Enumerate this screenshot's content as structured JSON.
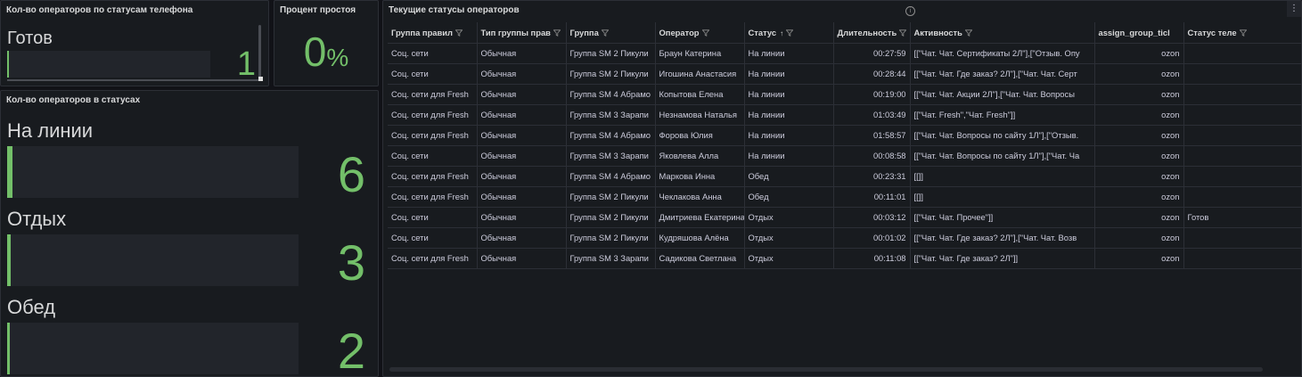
{
  "panels": {
    "phone_status": {
      "title": "Кол-во операторов по статусам телефона",
      "label": "Готов",
      "value": "1",
      "fill_fraction": 0.01
    },
    "idle_percent": {
      "title": "Процент простоя",
      "value": "0",
      "unit": "%"
    },
    "status_counts": {
      "title": "Кол-во операторов в статусах",
      "items": [
        {
          "label": "На линии",
          "value": "6",
          "fill_fraction": 0.02
        },
        {
          "label": "Отдых",
          "value": "3",
          "fill_fraction": 0.02
        },
        {
          "label": "Обед",
          "value": "2",
          "fill_fraction": 0.02
        }
      ]
    },
    "current_statuses": {
      "title": "Текущие статусы операторов",
      "info_icon": "info-circle-icon",
      "menu_icon": "more-vertical-icon",
      "columns": [
        "Группа правил",
        "Тип группы прав",
        "Группа",
        "Оператор",
        "Статус",
        "Длительность",
        "Активность",
        "assign_group_ticl",
        "Статус теле"
      ],
      "sort_icon": "arrow-up-icon",
      "filter_icon": "filter-icon",
      "rows": [
        [
          "Соц. сети",
          "Обычная",
          "Группа SM 2 Пикули",
          "Браун Катерина",
          "На линии",
          "00:27:59",
          "[[\"Чат. Чат. Сертификаты 2Л\"],[\"Отзыв. Опу",
          "ozon",
          ""
        ],
        [
          "Соц. сети",
          "Обычная",
          "Группа SM 2 Пикули",
          "Игошина Анастасия",
          "На линии",
          "00:28:44",
          "[[\"Чат. Чат. Где заказ? 2Л\"],[\"Чат. Чат. Серт",
          "ozon",
          ""
        ],
        [
          "Соц. сети для Fresh",
          "Обычная",
          "Группа SM 4 Абрамо",
          "Копытова Елена",
          "На линии",
          "00:19:00",
          "[[\"Чат. Чат. Акции 2Л\"],[\"Чат. Чат. Вопросы",
          "ozon",
          ""
        ],
        [
          "Соц. сети для Fresh",
          "Обычная",
          "Группа SM 3 Зарапи",
          "Незнамова Наталья",
          "На линии",
          "01:03:49",
          "[[\"Чат. Fresh\",\"Чат. Fresh\"]]",
          "ozon",
          ""
        ],
        [
          "Соц. сети для Fresh",
          "Обычная",
          "Группа SM 4 Абрамо",
          "Форова Юлия",
          "На линии",
          "01:58:57",
          "[[\"Чат. Чат. Вопросы по сайту 1Л\"],[\"Отзыв.",
          "ozon",
          ""
        ],
        [
          "Соц. сети",
          "Обычная",
          "Группа SM 3 Зарапи",
          "Яковлева Алла",
          "На линии",
          "00:08:58",
          "[[\"Чат. Чат. Вопросы по сайту 1Л\"],[\"Чат. Ча",
          "ozon",
          ""
        ],
        [
          "Соц. сети для Fresh",
          "Обычная",
          "Группа SM 4 Абрамо",
          "Маркова Инна",
          "Обед",
          "00:23:31",
          "[[]]",
          "ozon",
          ""
        ],
        [
          "Соц. сети для Fresh",
          "Обычная",
          "Группа SM 2 Пикули",
          "Чеклакова Анна",
          "Обед",
          "00:11:01",
          "[[]]",
          "ozon",
          ""
        ],
        [
          "Соц. сети",
          "Обычная",
          "Группа SM 2 Пикули",
          "Дмитриева Екатерина",
          "Отдых",
          "00:03:12",
          "[[\"Чат. Чат. Прочее\"]]",
          "ozon",
          "Готов"
        ],
        [
          "Соц. сети",
          "Обычная",
          "Группа SM 2 Пикули",
          "Кудряшова Алёна",
          "Отдых",
          "00:01:02",
          "[[\"Чат. Чат. Где заказ? 2Л\"],[\"Чат. Чат. Возв",
          "ozon",
          ""
        ],
        [
          "Соц. сети для Fresh",
          "Обычная",
          "Группа SM 3 Зарапи",
          "Садикова Светлана",
          "Отдых",
          "00:11:08",
          "[[\"Чат. Чат. Где заказ? 2Л\"]]",
          "ozon",
          ""
        ]
      ]
    }
  },
  "colors": {
    "accent_green": "#73bf69",
    "panel_bg": "#181b1f",
    "page_bg": "#111217"
  }
}
